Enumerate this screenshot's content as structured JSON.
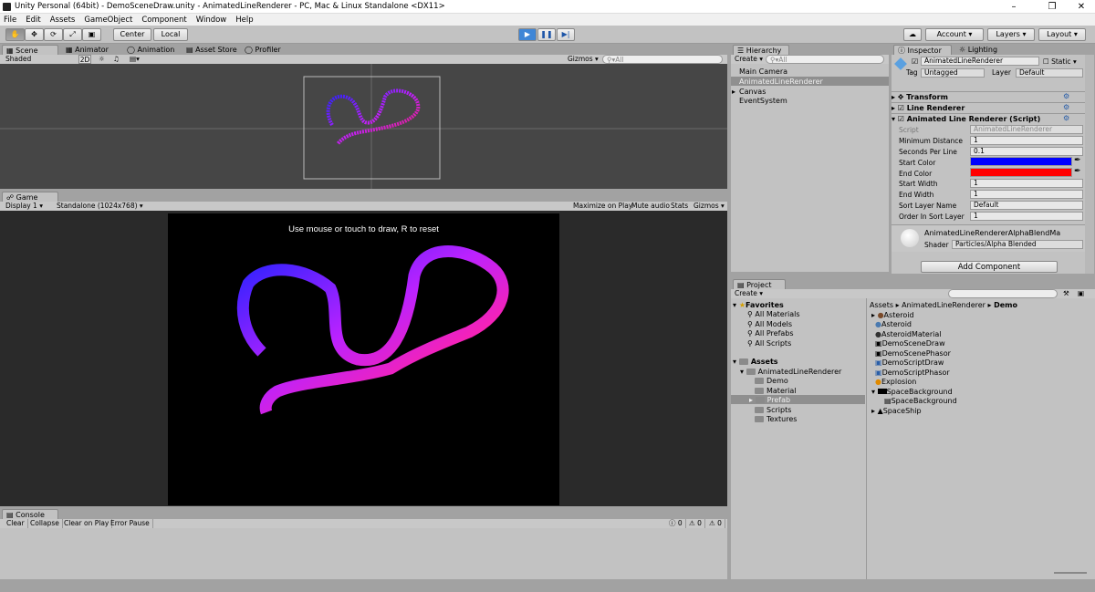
{
  "window": {
    "title": "Unity Personal (64bit) - DemoSceneDraw.unity - AnimatedLineRenderer - PC, Mac & Linux Standalone <DX11>"
  },
  "menu": [
    "File",
    "Edit",
    "Assets",
    "GameObject",
    "Component",
    "Window",
    "Help"
  ],
  "toolbar": {
    "pivot": "Center",
    "space": "Local",
    "account": "Account",
    "layers": "Layers",
    "layout": "Layout"
  },
  "scene_tabs": {
    "scene": "Scene",
    "animator": "Animator",
    "animation": "Animation",
    "asset_store": "Asset Store",
    "profiler": "Profiler"
  },
  "scene_bar": {
    "shading": "Shaded",
    "mode_2d": "2D",
    "gizmos": "Gizmos",
    "search": "All"
  },
  "game_tab": {
    "label": "Game",
    "display": "Display 1",
    "resolution": "Standalone (1024x768)",
    "maximize": "Maximize on Play",
    "mute": "Mute audio",
    "stats": "Stats",
    "gizmos": "Gizmos"
  },
  "game_view": {
    "hint": "Use mouse or touch to draw, R to reset"
  },
  "hierarchy": {
    "tab": "Hierarchy",
    "create": "Create",
    "search": "All",
    "items": [
      "Main Camera",
      "AnimatedLineRenderer",
      "Canvas",
      "EventSystem"
    ]
  },
  "inspector": {
    "tab": "Inspector",
    "lighting_tab": "Lighting",
    "object_name": "AnimatedLineRenderer",
    "static": "Static",
    "tag_label": "Tag",
    "tag": "Untagged",
    "layer_label": "Layer",
    "layer": "Default",
    "components": [
      "Transform",
      "Line Renderer",
      "Animated Line Renderer (Script)"
    ],
    "script_label": "Script",
    "script_value": "AnimatedLineRenderer",
    "props": [
      {
        "label": "Minimum Distance",
        "value": "1"
      },
      {
        "label": "Seconds Per Line",
        "value": "0.1"
      },
      {
        "label": "Start Color",
        "value": ""
      },
      {
        "label": "End Color",
        "value": ""
      },
      {
        "label": "Start Width",
        "value": "1"
      },
      {
        "label": "End Width",
        "value": "1"
      },
      {
        "label": "Sort Layer Name",
        "value": "Default"
      },
      {
        "label": "Order In Sort Layer",
        "value": "1"
      }
    ],
    "start_color": "#0000ff",
    "end_color": "#ff0000",
    "material_name": "AnimatedLineRendererAlphaBlendMa",
    "shader_label": "Shader",
    "shader": "Particles/Alpha Blended",
    "add_component": "Add Component"
  },
  "project": {
    "tab": "Project",
    "create": "Create",
    "favorites": "Favorites",
    "fav_items": [
      "All Materials",
      "All Models",
      "All Prefabs",
      "All Scripts"
    ],
    "assets": "Assets",
    "tree": [
      "AnimatedLineRenderer",
      "Demo",
      "Material",
      "Prefab",
      "Scripts",
      "Textures"
    ],
    "breadcrumb": [
      "Assets",
      "AnimatedLineRenderer",
      "Demo"
    ],
    "files": [
      "Asteroid",
      "Asteroid",
      "AsteroidMaterial",
      "DemoSceneDraw",
      "DemoScenePhasor",
      "DemoScriptDraw",
      "DemoScriptPhasor",
      "Explosion",
      "SpaceBackground",
      "SpaceBackground",
      "SpaceShip"
    ]
  },
  "console": {
    "tab": "Console",
    "clear": "Clear",
    "collapse": "Collapse",
    "clear_on_play": "Clear on Play",
    "error_pause": "Error Pause",
    "counts": [
      "0",
      "0",
      "0"
    ]
  }
}
